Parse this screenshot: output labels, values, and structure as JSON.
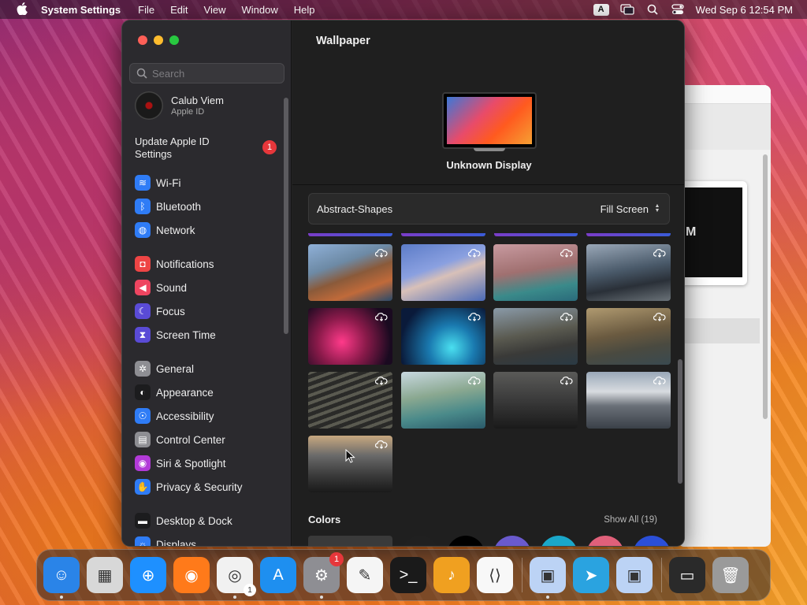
{
  "menubar": {
    "app_name": "System Settings",
    "menus": [
      "File",
      "Edit",
      "View",
      "Window",
      "Help"
    ],
    "input_source": "A",
    "clock": "Wed Sep 6  12:54 PM"
  },
  "background_window": {
    "snippet": "M"
  },
  "sidebar": {
    "search_placeholder": "Search",
    "profile": {
      "name": "Calub Viem",
      "subtitle": "Apple ID"
    },
    "update": {
      "label": "Update Apple ID Settings",
      "badge": "1"
    },
    "items": [
      {
        "label": "Wi-Fi",
        "icon": "wifi-icon",
        "color": "#2f7cf6"
      },
      {
        "label": "Bluetooth",
        "icon": "bluetooth-icon",
        "color": "#2f7cf6"
      },
      {
        "label": "Network",
        "icon": "globe-icon",
        "color": "#2f7cf6"
      },
      {
        "label": "Notifications",
        "icon": "bell-icon",
        "color": "#ee4545"
      },
      {
        "label": "Sound",
        "icon": "speaker-icon",
        "color": "#ee4560"
      },
      {
        "label": "Focus",
        "icon": "moon-icon",
        "color": "#5a4bd6"
      },
      {
        "label": "Screen Time",
        "icon": "hourglass-icon",
        "color": "#5a4bd6"
      },
      {
        "label": "General",
        "icon": "gear-icon",
        "color": "#8e8e93"
      },
      {
        "label": "Appearance",
        "icon": "appearance-icon",
        "color": "#1c1c1e"
      },
      {
        "label": "Accessibility",
        "icon": "accessibility-icon",
        "color": "#2f7cf6"
      },
      {
        "label": "Control Center",
        "icon": "control-center-icon",
        "color": "#8e8e93"
      },
      {
        "label": "Siri & Spotlight",
        "icon": "siri-icon",
        "color": "#b23ad8"
      },
      {
        "label": "Privacy & Security",
        "icon": "hand-icon",
        "color": "#2f7cf6"
      },
      {
        "label": "Desktop & Dock",
        "icon": "dock-icon",
        "color": "#1c1c1e"
      },
      {
        "label": "Displays",
        "icon": "display-icon",
        "color": "#2f7cf6"
      }
    ]
  },
  "content": {
    "title": "Wallpaper",
    "display_name": "Unknown Display",
    "picker": {
      "collection": "Abstract-Shapes",
      "fill_mode": "Fill Screen"
    },
    "colors_heading": "Colors",
    "show_all": "Show All (19)",
    "swatch_colors": [
      "#3a3a3a",
      "#202020",
      "#000000",
      "#6a5acd",
      "#1aa7c9",
      "#e0607a",
      "#2b4fd8"
    ]
  },
  "dock": {
    "apps": [
      {
        "name": "finder",
        "bg": "#2a84e8",
        "glyph": "☺",
        "running": true
      },
      {
        "name": "launchpad",
        "bg": "#d8d8d8",
        "glyph": "▦",
        "running": false
      },
      {
        "name": "safari",
        "bg": "#1e90ff",
        "glyph": "⊕",
        "running": false
      },
      {
        "name": "firefox",
        "bg": "#ff7a1a",
        "glyph": "◉",
        "running": false
      },
      {
        "name": "chrome",
        "bg": "#f1f1f1",
        "glyph": "◎",
        "running": true,
        "badge": "1",
        "badge_style": "gray"
      },
      {
        "name": "app-store",
        "bg": "#1e8ff0",
        "glyph": "A",
        "running": false
      },
      {
        "name": "system-settings",
        "bg": "#8e8e93",
        "glyph": "⚙",
        "running": true,
        "badge": "1"
      },
      {
        "name": "textedit",
        "bg": "#f5f5f5",
        "glyph": "✎",
        "running": false
      },
      {
        "name": "terminal",
        "bg": "#1a1a1a",
        "glyph": ">_",
        "running": false
      },
      {
        "name": "garageband",
        "bg": "#f0a020",
        "glyph": "♪",
        "running": false
      },
      {
        "name": "vscode",
        "bg": "#f8f8f8",
        "glyph": "⟨⟩",
        "running": false
      }
    ],
    "apps_right": [
      {
        "name": "virtualbox",
        "bg": "#bcd3f5",
        "glyph": "▣",
        "running": true
      },
      {
        "name": "telegram",
        "bg": "#2aa3e0",
        "glyph": "➤",
        "running": false
      },
      {
        "name": "virtualbox-2",
        "bg": "#bcd3f5",
        "glyph": "▣",
        "running": false
      }
    ],
    "trailing": [
      {
        "name": "minimized-window",
        "bg": "#2a2a2a",
        "glyph": "▭"
      },
      {
        "name": "trash",
        "bg": "#9a9a9a",
        "glyph": "🗑"
      }
    ]
  }
}
